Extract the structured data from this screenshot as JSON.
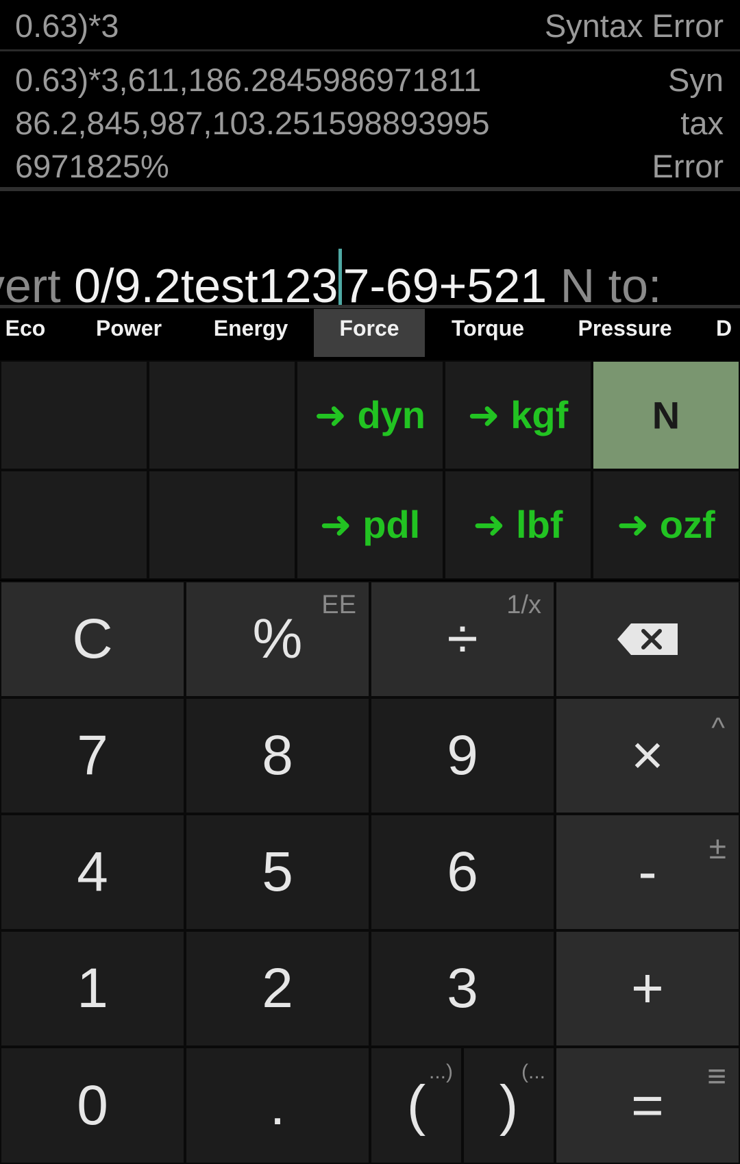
{
  "history": [
    {
      "expr": "0.63)*3",
      "result": "Syntax Error"
    },
    {
      "expr_lines": [
        "0.63)*3,611,186.2845986971811",
        "86.2,845,987,103.251598893995",
        "6971825%"
      ],
      "result_lines": [
        "Syn",
        "tax",
        "Error"
      ]
    }
  ],
  "display": {
    "prefix": "vert ",
    "before_cursor": "0/9.2test123",
    "after_cursor": "7-69+521",
    "suffix": " N to:"
  },
  "tabs": [
    "Eco",
    "Power",
    "Energy",
    "Force",
    "Torque",
    "Pressure",
    "D"
  ],
  "active_tab": "Force",
  "conversions": {
    "row1": [
      "",
      "",
      "➜ dyn",
      "➜ kgf",
      "N"
    ],
    "row2": [
      "",
      "",
      "➜ pdl",
      "➜ lbf",
      "➜ ozf"
    ],
    "selected": "N"
  },
  "keys": {
    "clear": "C",
    "percent": "%",
    "percent_sub": "EE",
    "divide": "÷",
    "divide_sub": "1/x",
    "seven": "7",
    "eight": "8",
    "nine": "9",
    "multiply": "×",
    "multiply_sub": "^",
    "four": "4",
    "five": "5",
    "six": "6",
    "minus": "-",
    "minus_sub": "±",
    "one": "1",
    "two": "2",
    "three": "3",
    "plus": "+",
    "zero": "0",
    "dot": ".",
    "lparen": "(",
    "lparen_sub": "...)",
    "rparen": ")",
    "rparen_sub": "(...",
    "equals": "=",
    "equals_sub": "≡"
  },
  "colors": {
    "accent_green": "#22c322",
    "selected_unit_bg": "#7a9670",
    "cursor": "#4fa9a4"
  }
}
